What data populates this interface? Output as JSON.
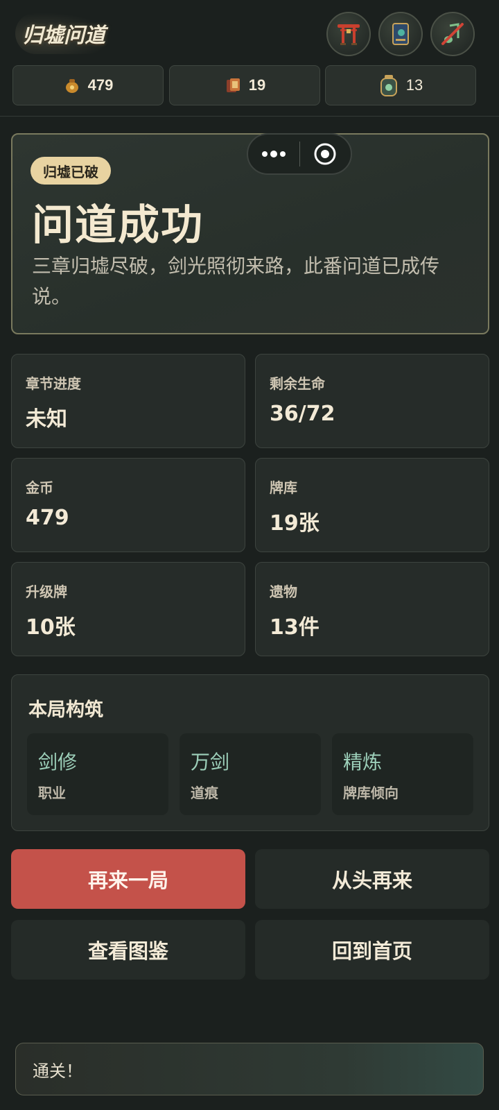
{
  "header": {
    "logo_text": "归墟问道",
    "icons": [
      "shrine-gate-icon",
      "codex-book-icon",
      "music-muted-icon"
    ],
    "resources": [
      {
        "icon": "gold-pouch-icon",
        "value": "479"
      },
      {
        "icon": "deck-cards-icon",
        "value": "19"
      },
      {
        "icon": "relic-jar-icon",
        "value": "13"
      }
    ]
  },
  "hero": {
    "tag": "归墟已破",
    "title": "问道成功",
    "description": "三章归墟尽破，剑光照彻来路，此番问道已成传说。"
  },
  "capsule": {
    "more_icon": "more-dots-icon",
    "close_icon": "target-circle-icon"
  },
  "stats": [
    {
      "label": "章节进度",
      "value": "未知"
    },
    {
      "label": "剩余生命",
      "value": "36/72"
    },
    {
      "label": "金币",
      "value": "479"
    },
    {
      "label": "牌库",
      "value": "19张"
    },
    {
      "label": "升级牌",
      "value": "10张"
    },
    {
      "label": "遗物",
      "value": "13件"
    }
  ],
  "build": {
    "title": "本局构筑",
    "items": [
      {
        "name": "剑修",
        "sub": "职业"
      },
      {
        "name": "万剑",
        "sub": "道痕"
      },
      {
        "name": "精炼",
        "sub": "牌库倾向"
      }
    ]
  },
  "buttons": {
    "again": "再来一局",
    "restart": "从头再来",
    "codex": "查看图鉴",
    "home": "回到首页"
  },
  "toast": "通关！",
  "colors": {
    "accent_red": "#c4524a",
    "tag_gold": "#e8d3a1",
    "build_name": "#9dd0ba"
  }
}
